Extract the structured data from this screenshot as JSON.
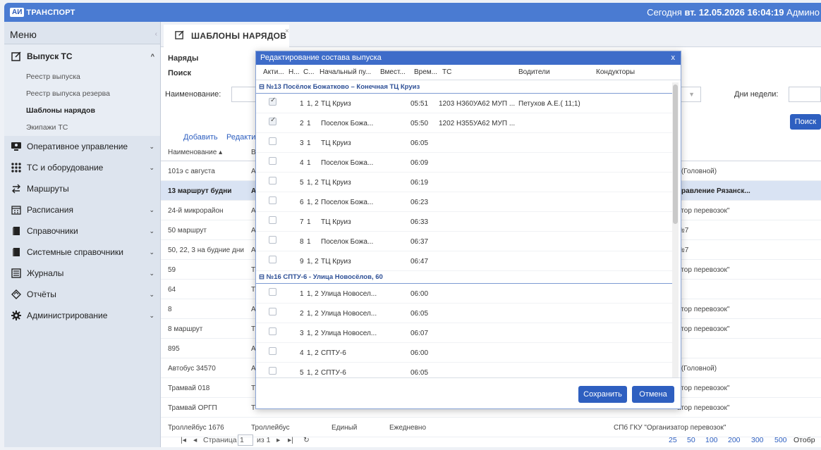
{
  "topbar": {
    "logo_box": "АИ",
    "logo_text": "ТРАНСПОРТ",
    "today_label": "Сегодня",
    "datetime": "вт. 12.05.2026 16:04:19",
    "user": "Админо"
  },
  "sidebar": {
    "title": "Меню",
    "sections": [
      {
        "label": "Выпуск ТС",
        "icon": "edit-icon",
        "open": true
      },
      {
        "label": "Оперативное управление",
        "icon": "monitor-icon"
      },
      {
        "label": "ТС и оборудование",
        "icon": "grid-icon"
      },
      {
        "label": "Маршруты",
        "icon": "route-icon"
      },
      {
        "label": "Расписания",
        "icon": "calendar-icon"
      },
      {
        "label": "Справочники",
        "icon": "book-icon"
      },
      {
        "label": "Системные справочники",
        "icon": "book-icon"
      },
      {
        "label": "Журналы",
        "icon": "journal-icon"
      },
      {
        "label": "Отчёты",
        "icon": "report-icon"
      },
      {
        "label": "Администрирование",
        "icon": "gear-icon"
      }
    ],
    "sub_items": [
      "Реестр выпуска",
      "Реестр выпуска резерва",
      "Шаблоны нарядов",
      "Экипажи ТС"
    ]
  },
  "main": {
    "tab_title": "ШАБЛОНЫ НАРЯДОВ",
    "tab_close": "×",
    "naryady_label": "Наряды",
    "search_label": "Поиск",
    "name_label": "Наименование:",
    "weekdays_label": "Дни недели:",
    "search_button": "Поиск",
    "add_link": "Добавить",
    "edit_link": "Редакти",
    "col_name": "Наименование ▴",
    "col_b": "В",
    "rows": [
      {
        "name": "101э с августа",
        "b": "А",
        "right": "К(Головной)"
      },
      {
        "name": "13 маршрут будни",
        "b": "А",
        "right": "правление Рязанск...",
        "selected": true
      },
      {
        "name": "24-й микрорайон",
        "b": "А",
        "right": "атор перевозок\""
      },
      {
        "name": "50 маршрут",
        "b": "А",
        "right": "№7"
      },
      {
        "name": "50, 22, 3 на будние дни",
        "b": "А",
        "right": "№7"
      },
      {
        "name": "59",
        "b": "Т",
        "right": "атор перевозок\""
      },
      {
        "name": "64",
        "b": "Т",
        "right": ""
      },
      {
        "name": "8",
        "b": "А",
        "right": "атор перевозок\""
      },
      {
        "name": "8 маршрут",
        "b": "Т",
        "right": "атор перевозок\""
      },
      {
        "name": "895",
        "b": "А",
        "right": ""
      },
      {
        "name": "Автобус 34570",
        "b": "А",
        "right": "К(Головной)"
      },
      {
        "name": "Трамвай 018",
        "b": "Т",
        "right": "атор перевозок\""
      },
      {
        "name": "Трамвай ОРГП",
        "b": "Т",
        "right": "атор перевозок\""
      },
      {
        "name": "Троллейбус 1676",
        "b": "Троллейбус",
        "c": "Единый",
        "d": "Ежедневно",
        "right": "СПб ГКУ \"Организатор перевозок\""
      }
    ],
    "pager": {
      "page_label": "Страница",
      "page_value": "1",
      "of_label": "из 1",
      "sizes": [
        "25",
        "50",
        "100",
        "200",
        "300",
        "500"
      ],
      "display_label": "Отобр"
    }
  },
  "dialog": {
    "title": "Редактирование состава выпуска",
    "close": "x",
    "headers": [
      "Акти...",
      "Н...",
      "С...",
      "Начальный пу...",
      "Вмест...",
      "Врем...",
      "ТС",
      "Водители",
      "Кондукторы"
    ],
    "groups": [
      {
        "title": "№13 Посёлок Божатково – Конечная ТЦ Круиз",
        "rows": [
          {
            "checked": true,
            "n": "1",
            "s": "1, 2",
            "start": "ТЦ Круиз",
            "time": "05:51",
            "ts": "1203 Н360УА62 МУП ...",
            "driver": "Петухов А.Е.( 11;1)"
          },
          {
            "checked": true,
            "n": "2",
            "s": "1",
            "start": "Поселок Божа...",
            "time": "05:50",
            "ts": "1202 Н355УА62 МУП ...",
            "driver": ""
          },
          {
            "checked": false,
            "n": "3",
            "s": "1",
            "start": "ТЦ Круиз",
            "time": "06:05",
            "ts": "",
            "driver": ""
          },
          {
            "checked": false,
            "n": "4",
            "s": "1",
            "start": "Поселок Божа...",
            "time": "06:09",
            "ts": "",
            "driver": ""
          },
          {
            "checked": false,
            "n": "5",
            "s": "1, 2",
            "start": "ТЦ Круиз",
            "time": "06:19",
            "ts": "",
            "driver": ""
          },
          {
            "checked": false,
            "n": "6",
            "s": "1, 2",
            "start": "Поселок Божа...",
            "time": "06:23",
            "ts": "",
            "driver": ""
          },
          {
            "checked": false,
            "n": "7",
            "s": "1",
            "start": "ТЦ Круиз",
            "time": "06:33",
            "ts": "",
            "driver": ""
          },
          {
            "checked": false,
            "n": "8",
            "s": "1",
            "start": "Поселок Божа...",
            "time": "06:37",
            "ts": "",
            "driver": ""
          },
          {
            "checked": false,
            "n": "9",
            "s": "1, 2",
            "start": "ТЦ Круиз",
            "time": "06:47",
            "ts": "",
            "driver": ""
          }
        ]
      },
      {
        "title": "№16 СПТУ-6 - Улица Новосёлов, 60",
        "rows": [
          {
            "checked": false,
            "n": "1",
            "s": "1, 2",
            "start": "Улица Новосел...",
            "time": "06:00",
            "ts": "",
            "driver": ""
          },
          {
            "checked": false,
            "n": "2",
            "s": "1, 2",
            "start": "Улица Новосел...",
            "time": "06:05",
            "ts": "",
            "driver": ""
          },
          {
            "checked": false,
            "n": "3",
            "s": "1, 2",
            "start": "Улица Новосел...",
            "time": "06:07",
            "ts": "",
            "driver": ""
          },
          {
            "checked": false,
            "n": "4",
            "s": "1, 2",
            "start": "СПТУ-6",
            "time": "06:00",
            "ts": "",
            "driver": ""
          },
          {
            "checked": false,
            "n": "5",
            "s": "1, 2",
            "start": "СПТУ-6",
            "time": "06:05",
            "ts": "",
            "driver": ""
          }
        ]
      }
    ],
    "save_button": "Сохранить",
    "cancel_button": "Отмена"
  },
  "colors": {
    "accent": "#3e6cc9",
    "topbar": "#4a7bd2",
    "sidebar": "#dde4ee"
  }
}
